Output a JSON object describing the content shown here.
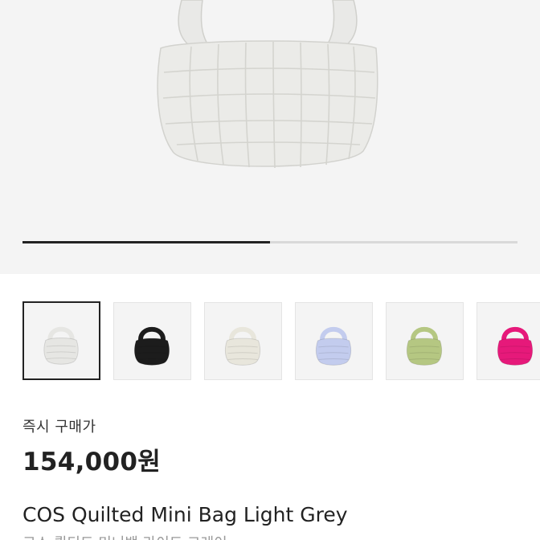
{
  "gallery": {
    "progress_fraction": 0.5,
    "main_image_icon": "quilted-bag-light-grey-icon"
  },
  "thumbnails": [
    {
      "icon": "quilted-bag-light-grey-icon",
      "color": "#e6e6e3",
      "selected": true
    },
    {
      "icon": "quilted-bag-black-icon",
      "color": "#1c1c1c",
      "selected": false
    },
    {
      "icon": "quilted-bag-cream-icon",
      "color": "#e8e6dc",
      "selected": false
    },
    {
      "icon": "quilted-bag-light-blue-icon",
      "color": "#c3ccee",
      "selected": false
    },
    {
      "icon": "quilted-bag-green-icon",
      "color": "#b5c782",
      "selected": false
    },
    {
      "icon": "quilted-bag-pink-icon",
      "color": "#e6197a",
      "selected": false
    }
  ],
  "price": {
    "label": "즉시 구매가",
    "value": "154,000원"
  },
  "product": {
    "title": "COS Quilted Mini Bag Light Grey",
    "subtitle": "코스 퀼티드 미니백 라이트 그레이"
  }
}
